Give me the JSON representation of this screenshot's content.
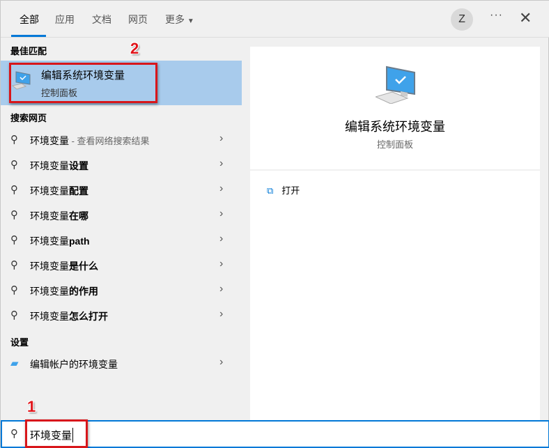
{
  "tabs": [
    "全部",
    "应用",
    "文档",
    "网页",
    "更多"
  ],
  "avatar": "Z",
  "more_icon": "···",
  "close_icon": "✕",
  "sections": {
    "best": "最佳匹配",
    "web": "搜索网页",
    "settings": "设置"
  },
  "best_match": {
    "title": "编辑系统环境变量",
    "subtitle": "控制面板"
  },
  "annotations": {
    "step1": "1",
    "step2": "2"
  },
  "web_results": [
    {
      "prefix": "环境变量",
      "bold": "",
      "hint": " - 查看网络搜索结果"
    },
    {
      "prefix": "环境变量",
      "bold": "设置",
      "hint": ""
    },
    {
      "prefix": "环境变量",
      "bold": "配置",
      "hint": ""
    },
    {
      "prefix": "环境变量",
      "bold": "在哪",
      "hint": ""
    },
    {
      "prefix": "环境变量",
      "bold": "path",
      "hint": ""
    },
    {
      "prefix": "环境变量",
      "bold": "是什么",
      "hint": ""
    },
    {
      "prefix": "环境变量",
      "bold": "的作用",
      "hint": ""
    },
    {
      "prefix": "环境变量",
      "bold": "怎么打开",
      "hint": ""
    }
  ],
  "settings_results": [
    {
      "label": "编辑帐户的环境变量"
    }
  ],
  "preview": {
    "title": "编辑系统环境变量",
    "subtitle": "控制面板",
    "action": "打开"
  },
  "search": {
    "value": "环境变量"
  },
  "colors": {
    "accent": "#0078d7",
    "selected": "#a8cbec",
    "annotation": "#d8161b"
  }
}
